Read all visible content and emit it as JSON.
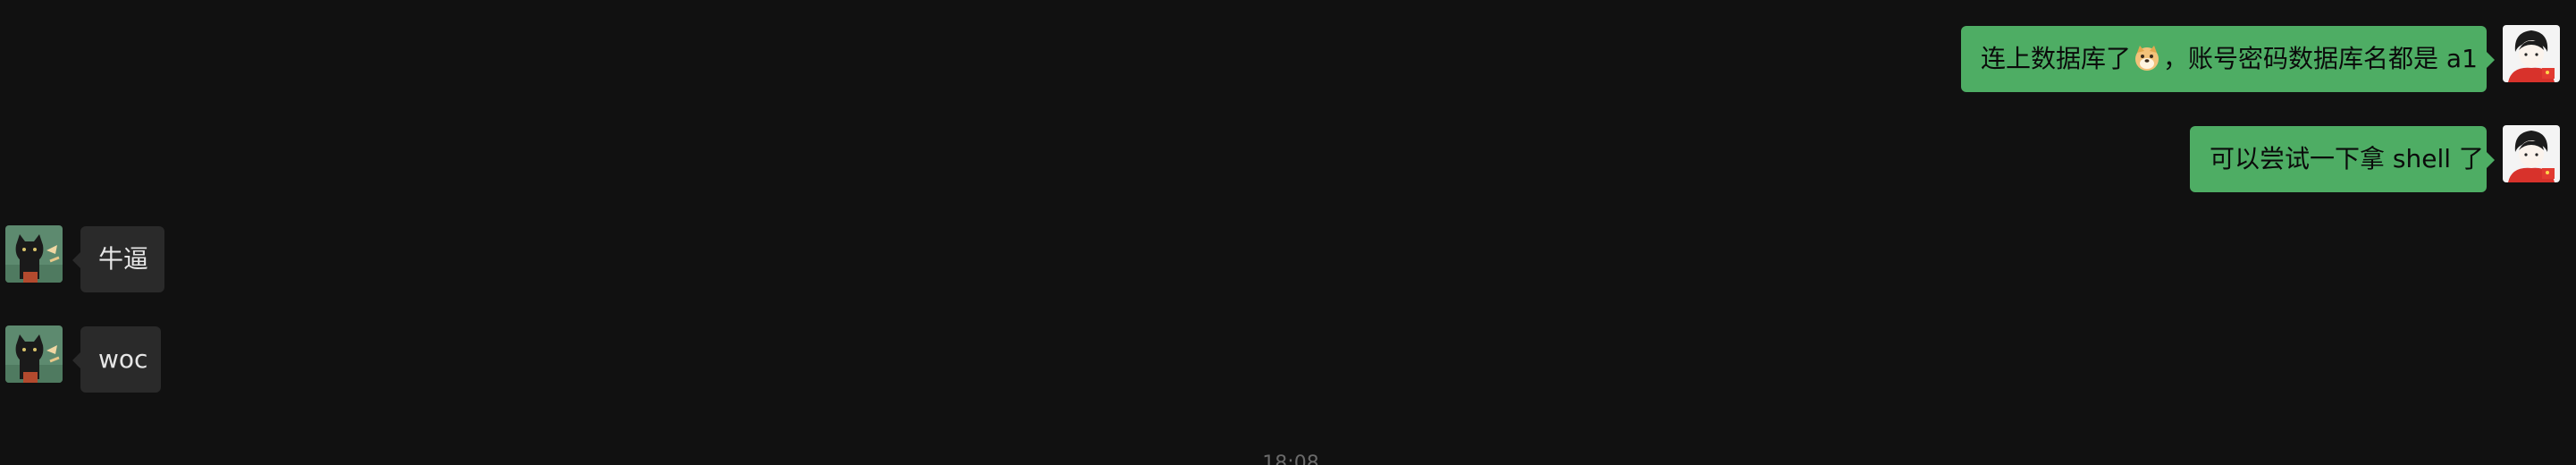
{
  "messages": [
    {
      "direction": "outgoing",
      "text_before_emoji": "连上数据库了",
      "emoji": "doge-emoji",
      "text_after_emoji": "，账号密码数据库名都是 a1"
    },
    {
      "direction": "outgoing",
      "text": "可以尝试一下拿 shell 了"
    },
    {
      "direction": "incoming",
      "text": "牛逼"
    },
    {
      "direction": "incoming",
      "text": "woc"
    }
  ],
  "timestamp": "18:08",
  "colors": {
    "background": "#111111",
    "outgoing_bubble": "#4ead64",
    "incoming_bubble": "#2a2a2a",
    "timestamp_text": "#6a6a6a"
  },
  "icons": {
    "self_avatar": "anime-character-avatar",
    "contact_avatar": "black-cat-avatar"
  }
}
